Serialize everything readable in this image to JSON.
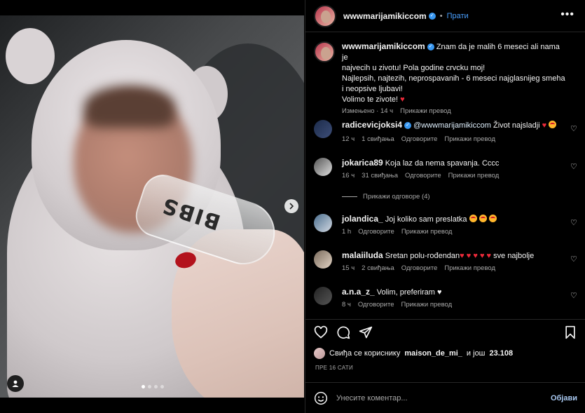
{
  "post": {
    "author": "wwwmarijamikiccom",
    "follow_label": "Прати",
    "more_label": "•••",
    "caption_lines": [
      "Znam da je malih 6 meseci ali nama je",
      "najvecih u zivotu! Pola godine crvcku moj!",
      "Najlepsih, najtezih, neprospavanih - 6 meseci najglasnijeg smeha",
      "i neopsive ljubavi!",
      "Volimo te zivote!"
    ],
    "caption_meta": {
      "edited": "Измењено · 14 ч",
      "translate": "Прикажи превод"
    },
    "media": {
      "bottle_text": "BIBS",
      "slide_count": 4,
      "active_slide": 1
    }
  },
  "comments": [
    {
      "username": "radicevicjoksi4",
      "verified": true,
      "mention": "@wwwmarijamikiccom",
      "text": "Život najsladji",
      "time": "12 ч",
      "likes": "1 свиђања",
      "reply": "Одговорите",
      "translate": "Прикажи превод"
    },
    {
      "username": "jokarica89",
      "text": "Koja laz da nema spavanja. Cccc",
      "time": "16 ч",
      "likes": "31 свиђања",
      "reply": "Одговорите",
      "translate": "Прикажи превод",
      "view_replies": "Прикажи одговоре (4)"
    },
    {
      "username": "jolandica_",
      "text": "Joj koliko sam preslatka",
      "time": "1 h",
      "reply": "Одговорите",
      "translate": "Прикажи превод"
    },
    {
      "username": "malaiiluda",
      "text": "Sretan polu-rođendan",
      "text_tail": "sve najbolje",
      "time": "15 ч",
      "likes": "2 свиђања",
      "reply": "Одговорите",
      "translate": "Прикажи превод"
    },
    {
      "username": "a.n.a_z_",
      "text": "Volim, preferiram",
      "time": "8 ч",
      "reply": "Одговорите",
      "translate": "Прикажи превод"
    }
  ],
  "likes": {
    "prefix": "Свиђа се кориснику",
    "user": "maison_de_mi_",
    "middle": "и још",
    "count": "23.108"
  },
  "timestamp": "ПРЕ 16 САТИ",
  "comment_box": {
    "placeholder": "Унесите коментар...",
    "post_label": "Објави"
  },
  "colors": {
    "background": "#000000",
    "follow_blue": "#4aa0ff",
    "heart_red": "#ed2a3a",
    "secondary_text": "#a8a8a8"
  },
  "icons": [
    "verified-badge-icon",
    "more-options-icon",
    "heart-icon",
    "comment-icon",
    "share-icon",
    "bookmark-icon",
    "emoji-icon",
    "next-arrow-icon",
    "user-tag-icon"
  ]
}
